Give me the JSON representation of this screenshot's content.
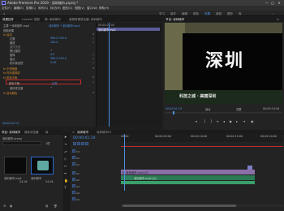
{
  "app": {
    "title": "Adobe Premiere Pro 2019 - 深圳城市.prproj *",
    "window_controls": [
      "—",
      "□",
      "✕"
    ]
  },
  "menu": [
    "文件(F)",
    "编辑(E)",
    "剪辑(C)",
    "序列(S)",
    "标记(M)",
    "图形(G)",
    "视图(V)",
    "窗口(W)",
    "帮助(H)"
  ],
  "workspace": {
    "tabs": [
      "学习",
      "组件",
      "编辑",
      "颜色",
      "效果",
      "音频",
      "图形",
      "库"
    ],
    "active": "效果"
  },
  "effect_controls": {
    "tabs": [
      "效果控件",
      "Lumetri 范围",
      "源: 深圳城市",
      "音频剪辑混合器: 深圳城市"
    ],
    "source_line": "主要 * 深圳城市.mp4",
    "clip_line": "深圳城市 * 深圳城市.mp4",
    "section_video": "视频效果",
    "items": [
      {
        "label": "fx 运动",
        "type": "fx"
      },
      {
        "label": "位置",
        "value": "960.0  540.0"
      },
      {
        "label": "缩放",
        "value": "100.0"
      },
      {
        "label": "缩放宽度",
        "value": ""
      },
      {
        "label": "等比缩放",
        "value": "✓"
      },
      {
        "label": "旋转",
        "value": "0.0"
      },
      {
        "label": "锚点",
        "value": "960.0  540.0"
      },
      {
        "label": "防闪烁滤镜",
        "value": "0.00"
      },
      {
        "label": "fx 不透明度",
        "type": "fx"
      },
      {
        "label": "fx 时间重映射",
        "type": "fx"
      },
      {
        "label": "fx 颜色平衡",
        "type": "fx"
      },
      {
        "label": "保持发光度",
        "value": "✓"
      },
      {
        "label": "fx 自动颜色",
        "type": "fx"
      }
    ],
    "highlight_label": "颜色平衡",
    "highlight_value": "正常",
    "timecode": "00:00:01:19"
  },
  "mini_timeline": {
    "timecode": "00:00:01:00",
    "clip_label": "深圳城市.mp4"
  },
  "program_monitor": {
    "tab": "节目: 深圳城市",
    "overlay_text": "深圳",
    "subtitle_text": "科技之城 · 美丽深圳",
    "timecode": "00:00:01:19",
    "fit": "适合",
    "quality": "完整",
    "duration": "00:00:24:16"
  },
  "project": {
    "tabs": [
      "项目: 深圳城市",
      "媒体浏览器",
      "库"
    ],
    "file": "深圳城市.prproj",
    "search_placeholder": "",
    "count": "1项",
    "items": [
      {
        "name": "深圳城市.mp4",
        "duration": "24:16"
      },
      {
        "name": "深圳城市",
        "duration": "24:16"
      }
    ]
  },
  "timeline": {
    "tabs": [
      "深圳城市",
      "深圳城市01"
    ],
    "timecode": "00:00:01:19",
    "ruler": [
      "00:00",
      "00:00:05:00",
      "00:00:10:00",
      "00:00:15:00",
      "00:00:20:00"
    ],
    "tracks": [
      "V3",
      "V2",
      "V1",
      "A1",
      "A2",
      "A3",
      "A4",
      "A5"
    ],
    "clip_video": "fx 深圳城市.mp4 [V]",
    "clip_audio": "深圳城市.mp4 [A]"
  },
  "colors": {
    "accent": "#4a90e2",
    "highlight_border": "#c42b2b",
    "video_clip": "#8a6fa8",
    "audio_clip": "#2e8a5a"
  }
}
